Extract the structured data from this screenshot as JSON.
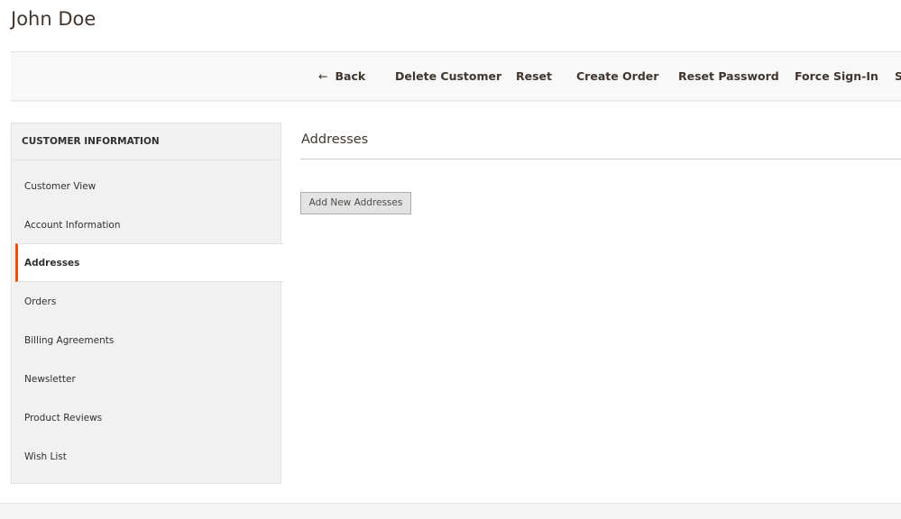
{
  "page": {
    "title": "John Doe"
  },
  "toolbar": {
    "back": "Back",
    "back_icon": "arrow-left-icon",
    "delete": "Delete Customer",
    "reset": "Reset",
    "create_order": "Create Order",
    "reset_password": "Reset Password",
    "force_signin": "Force Sign-In",
    "cut_off": "S"
  },
  "sidebar": {
    "heading": "CUSTOMER INFORMATION",
    "items": [
      {
        "label": "Customer View"
      },
      {
        "label": "Account Information"
      },
      {
        "label": "Addresses",
        "active": true
      },
      {
        "label": "Orders"
      },
      {
        "label": "Billing Agreements"
      },
      {
        "label": "Newsletter"
      },
      {
        "label": "Product Reviews"
      },
      {
        "label": "Wish List"
      }
    ]
  },
  "main": {
    "title": "Addresses",
    "add_button": "Add New Addresses"
  },
  "colors": {
    "accent": "#eb5202"
  }
}
